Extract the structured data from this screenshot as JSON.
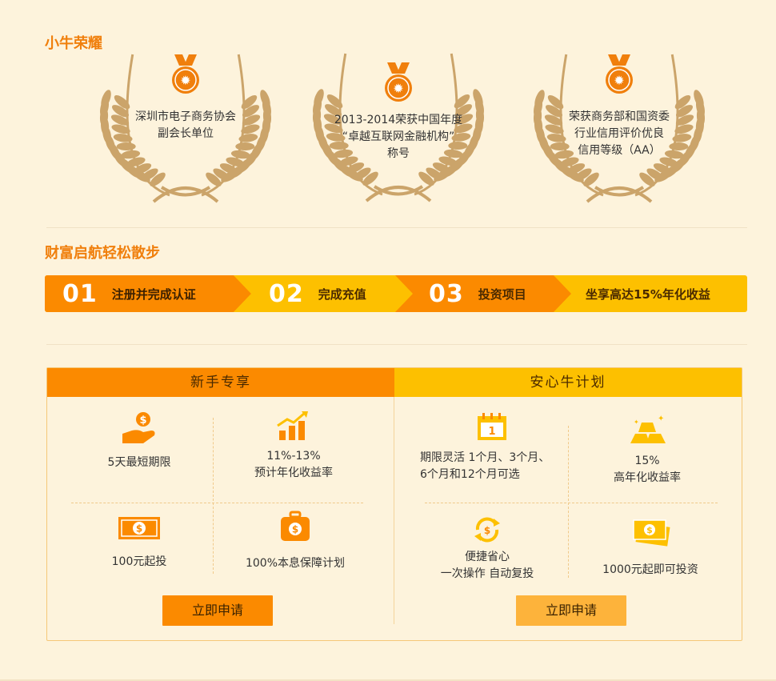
{
  "honors": {
    "title": "小牛荣耀",
    "items": [
      {
        "lines": [
          "深圳市电子商务协会",
          "副会长单位"
        ]
      },
      {
        "lines": [
          "2013-2014荣获中国年度",
          "“卓越互联网金融机构”",
          "称号"
        ]
      },
      {
        "lines": [
          "荣获商务部和国资委",
          "行业信用评价优良",
          "信用等级（AA）"
        ]
      }
    ]
  },
  "steps": {
    "title": "财富启航轻松散步",
    "items": [
      {
        "num": "01",
        "label": "注册并完成认证"
      },
      {
        "num": "02",
        "label": "完成充值"
      },
      {
        "num": "03",
        "label": "投资项目"
      },
      {
        "num": "",
        "label": "坐享高达15%年化收益"
      }
    ]
  },
  "newbie": {
    "header": "新手专享",
    "cells": [
      {
        "icon": "hand-dollar-icon",
        "lines": [
          "5天最短期限"
        ]
      },
      {
        "icon": "growth-chart-icon",
        "lines": [
          "11%-13%",
          "预计年化收益率"
        ]
      },
      {
        "icon": "banknote-icon",
        "lines": [
          "100元起投"
        ]
      },
      {
        "icon": "money-bag-icon",
        "lines": [
          "100%本息保障计划"
        ]
      }
    ],
    "button": "立即申请"
  },
  "plan": {
    "header": "安心牛计划",
    "cells": [
      {
        "icon": "calendar-icon",
        "lines": [
          "期限灵活  1个月、3个月、",
          "6个月和12个月可选"
        ]
      },
      {
        "icon": "gold-bars-icon",
        "lines": [
          "15%",
          "高年化收益率"
        ]
      },
      {
        "icon": "recycle-coin-icon",
        "lines": [
          "便捷省心",
          "一次操作 自动复投"
        ]
      },
      {
        "icon": "cash-stack-icon",
        "lines": [
          "1000元起即可投资"
        ]
      }
    ],
    "button": "立即申请"
  },
  "colors": {
    "accent": "#f07f0c",
    "orange": "#fb8a00",
    "yellow": "#fdc000",
    "wreath": "#cba46a"
  }
}
